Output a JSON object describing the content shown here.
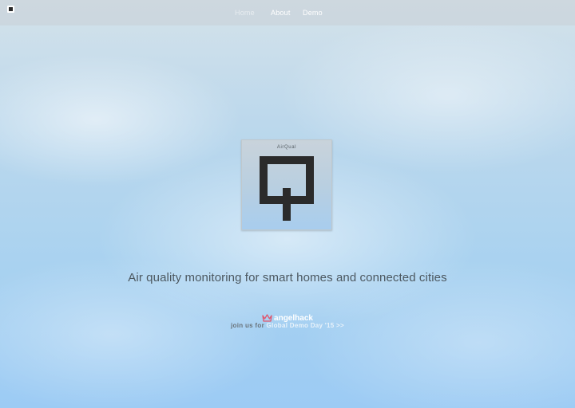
{
  "nav": {
    "items": [
      {
        "label": "Home",
        "active": true
      },
      {
        "label": "About",
        "active": false
      },
      {
        "label": "Demo",
        "active": false
      }
    ]
  },
  "hero": {
    "logo_title": "AirQual",
    "tagline": "Air quality monitoring for smart homes and connected cities"
  },
  "sponsor": {
    "logo_text": "angelhack",
    "join_prefix": "join us for",
    "event_link": "Global Demo Day '15  >>"
  },
  "colors": {
    "sky_top": "#d4e2ea",
    "sky_bottom": "#9ccbf4",
    "logo_mark": "#2b2b2b",
    "sponsor_icon": "#e0566e"
  }
}
